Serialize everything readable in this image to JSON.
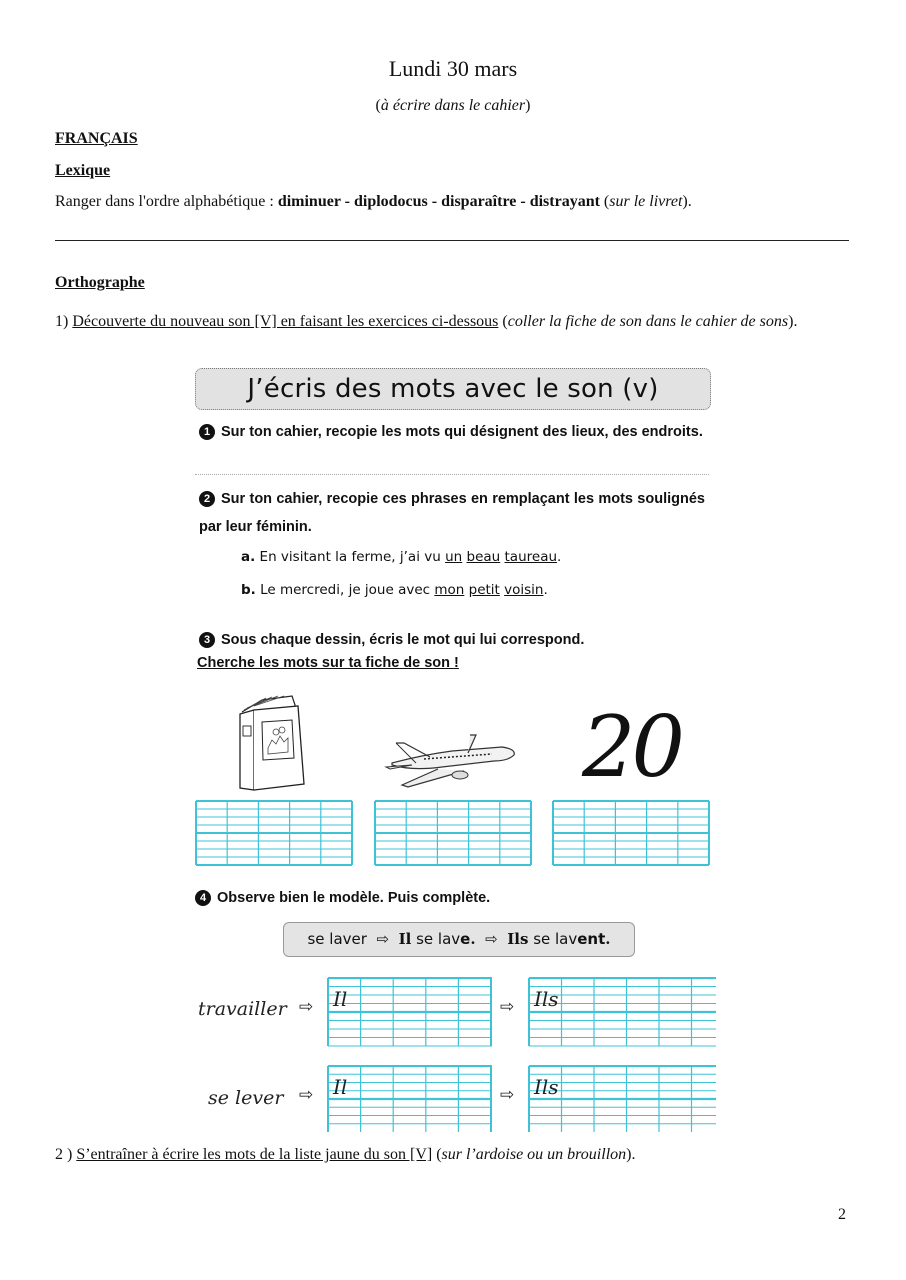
{
  "header": {
    "title": "Lundi 30 mars",
    "subtitle_open": "(",
    "subtitle_italic": "à écrire dans le cahier",
    "subtitle_close": ")"
  },
  "francais": {
    "heading": "FRANÇAIS",
    "lexique": {
      "heading": "Lexique",
      "instruction": "Ranger dans l'ordre alphabétique : ",
      "words": "diminuer - diplodocus - disparaître - distrayant",
      "note_open": " (",
      "note_italic": "sur le livret",
      "note_close": ")."
    }
  },
  "orthographe": {
    "heading": "Orthographe",
    "item1": {
      "number": "1) ",
      "underlined": "Découverte du nouveau son [V] en faisant les exercices ci-dessous",
      "note_open": " (",
      "note_italic": "coller la fiche de son dans le cahier de sons",
      "note_close": ")."
    },
    "item2": {
      "number": "2 ) ",
      "underlined": "S’entraîner à écrire les mots de la liste jaune du son [V]",
      "note_open": " (",
      "note_italic": "sur l’ardoise ou un brouillon",
      "note_close": ")."
    }
  },
  "worksheet": {
    "title": "J’écris des mots avec le son (v)",
    "exercise1": {
      "number": "1",
      "text": "Sur ton cahier, recopie les mots qui désignent des lieux, des endroits."
    },
    "exercise2": {
      "number": "2",
      "text": "Sur ton cahier, recopie ces phrases en remplaçant les mots soulignés par leur féminin.",
      "sentence_a": {
        "label": "a.",
        "before": " En visitant la ferme, j’ai vu ",
        "u1": "un",
        "u2": "beau",
        "u3": "taureau",
        "end": "."
      },
      "sentence_b": {
        "label": "b.",
        "before": " Le mercredi, je joue avec ",
        "u1": "mon",
        "u2": "petit",
        "u3": "voisin",
        "end": "."
      }
    },
    "exercise3": {
      "number": "3",
      "text": "Sous chaque dessin, écris le mot qui lui correspond.",
      "hint": "Cherche les mots sur ta fiche de son !",
      "pictures": [
        {
          "icon": "book-icon"
        },
        {
          "icon": "airplane-icon"
        },
        {
          "icon": "number-twenty",
          "label": "20"
        }
      ]
    },
    "exercise4": {
      "number": "4",
      "text": "Observe bien le modèle. Puis complète.",
      "model": {
        "verb": "se laver",
        "arrow": "⇨",
        "sing_pronoun": "Il",
        "sing_stem": " se lav",
        "sing_end": "e",
        "sing_dot": ".",
        "plur_pronoun": "Ils",
        "plur_stem": " se lav",
        "plur_end": "ent",
        "plur_dot": "."
      },
      "rows": [
        {
          "verb": "travailler",
          "arrow": "⇨",
          "sing_prefix": "Il",
          "plur_prefix": "Ils"
        },
        {
          "verb": "se lever",
          "arrow": "⇨",
          "sing_prefix": "Il",
          "plur_prefix": "Ils"
        }
      ]
    }
  },
  "footer": {
    "page_number": "2"
  },
  "colors": {
    "grid": "#3ec3d6",
    "banner_bg": "#e2e2e2",
    "text": "#111111"
  }
}
